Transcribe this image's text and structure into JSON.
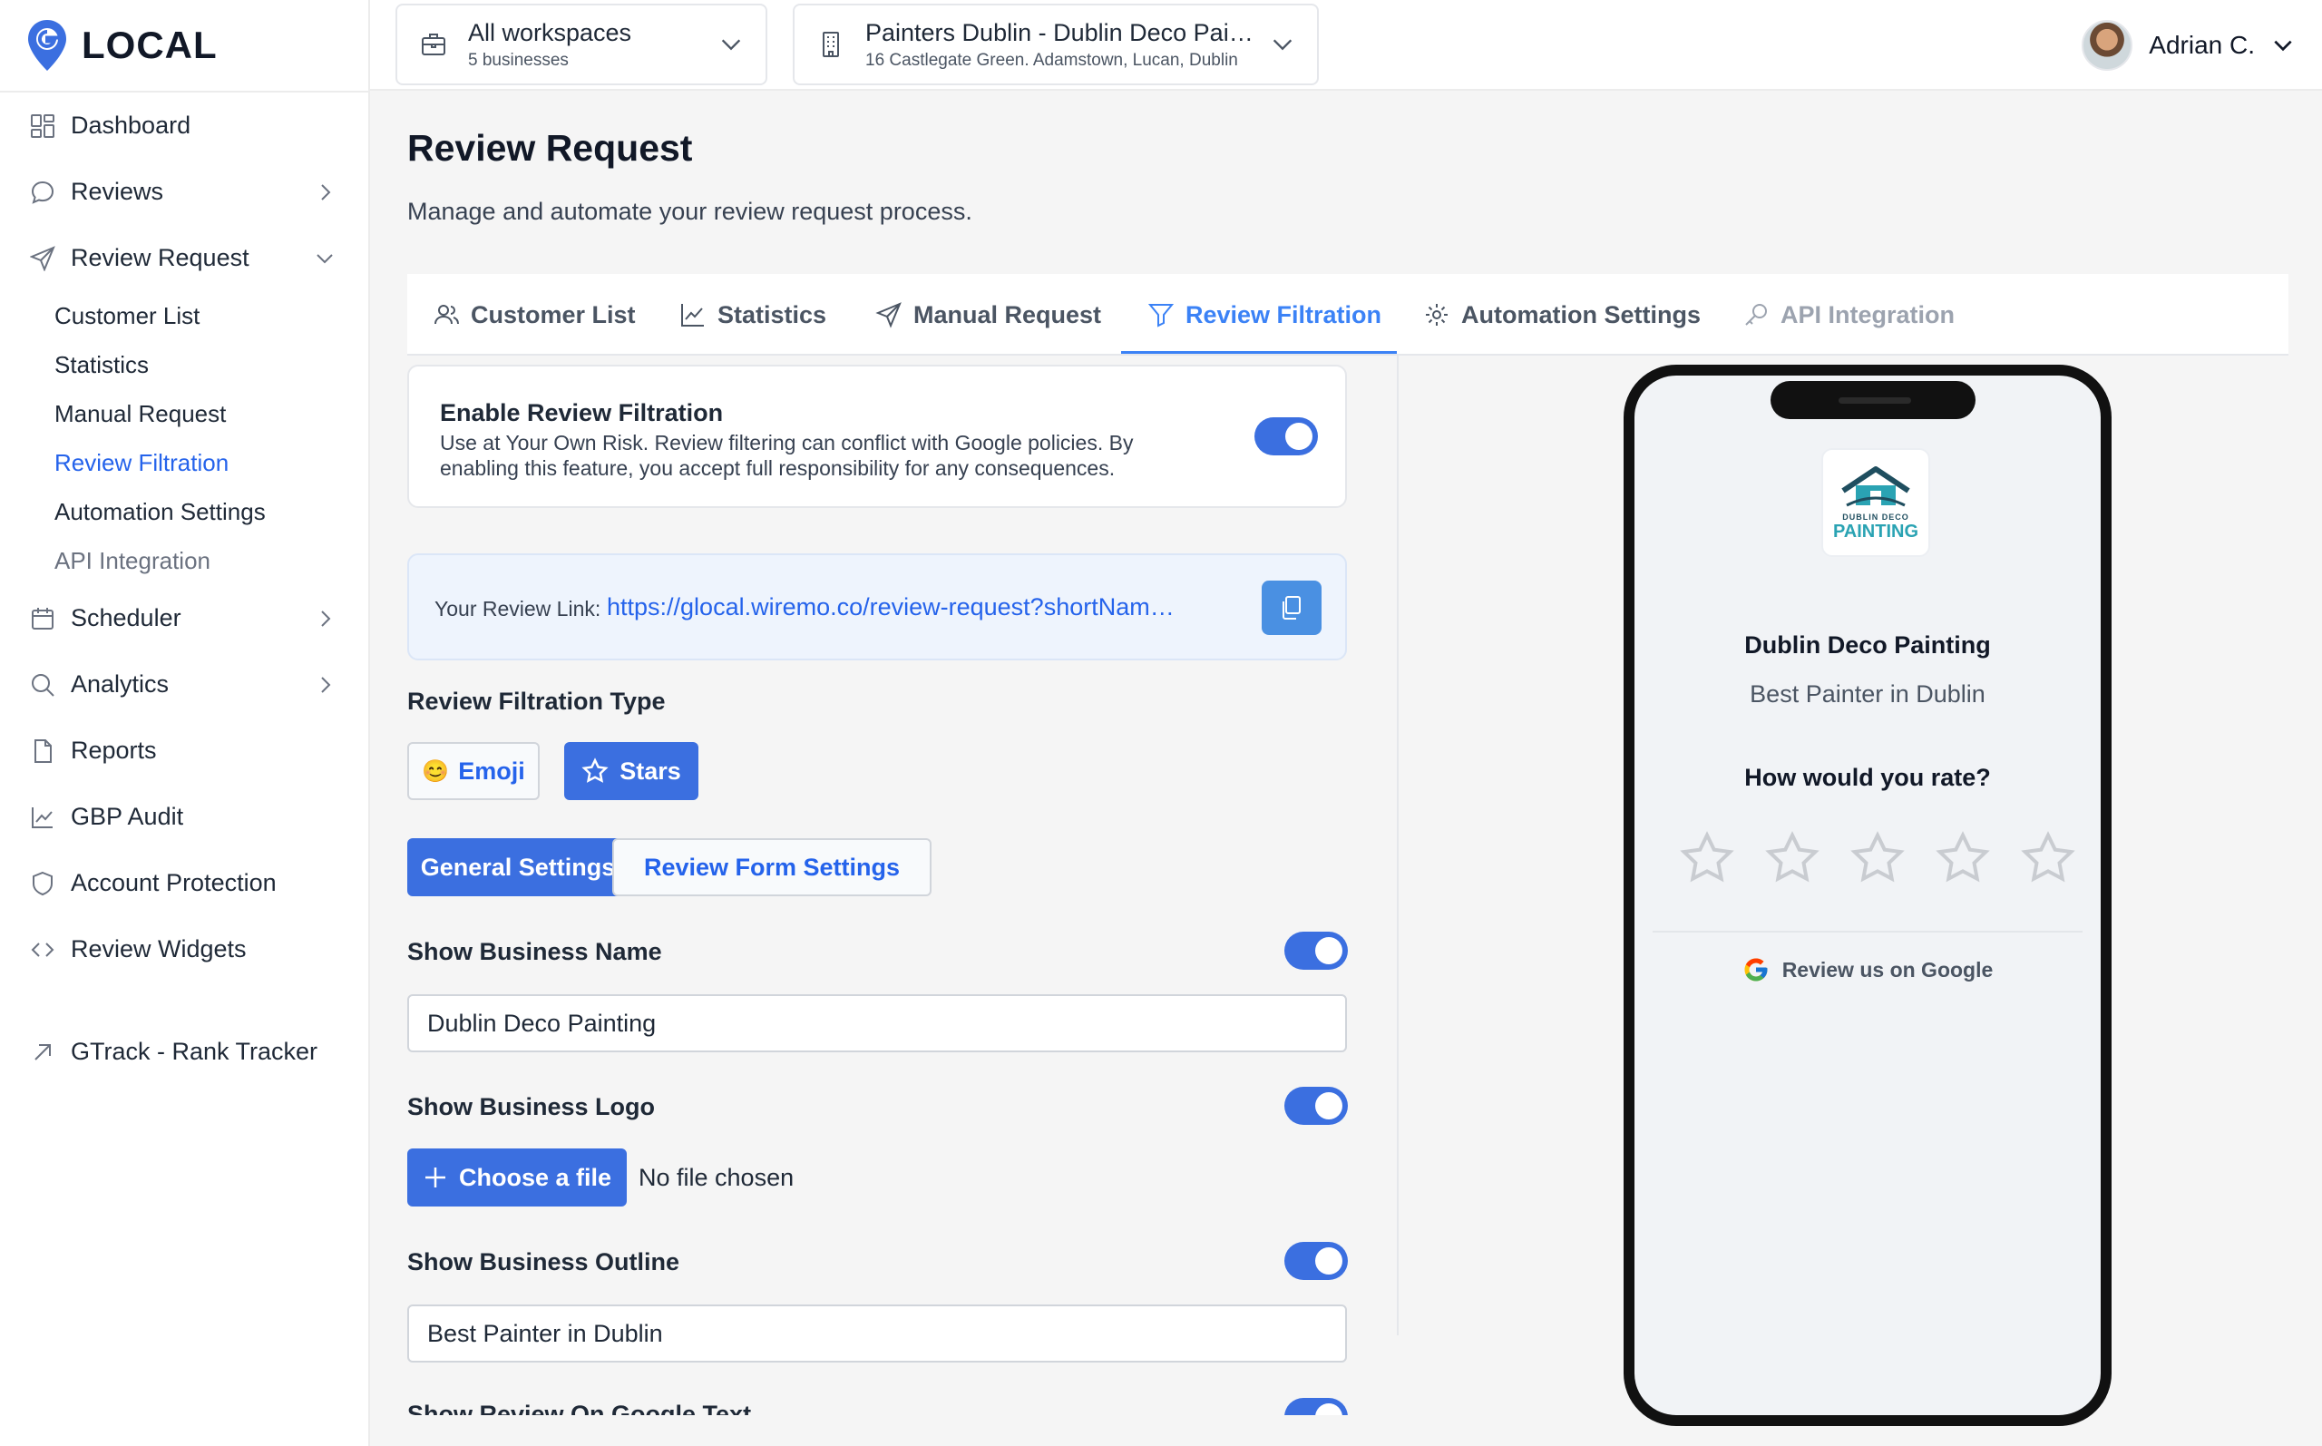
{
  "brand": {
    "name": "LOCAL"
  },
  "sidebar": {
    "items": [
      {
        "label": "Dashboard",
        "icon": "grid-icon"
      },
      {
        "label": "Reviews",
        "icon": "chat-icon"
      },
      {
        "label": "Review Request",
        "icon": "send-icon"
      },
      {
        "label": "Scheduler",
        "icon": "calendar-icon"
      },
      {
        "label": "Analytics",
        "icon": "search-icon"
      },
      {
        "label": "Reports",
        "icon": "file-icon"
      },
      {
        "label": "GBP Audit",
        "icon": "chart-line-icon"
      },
      {
        "label": "Account Protection",
        "icon": "shield-icon"
      },
      {
        "label": "Review Widgets",
        "icon": "code-icon"
      },
      {
        "label": "GTrack - Rank Tracker",
        "icon": "arrow-up-right-icon"
      }
    ],
    "sub_items": [
      "Customer List",
      "Statistics",
      "Manual Request",
      "Review Filtration",
      "Automation Settings",
      "API Integration"
    ]
  },
  "topbar": {
    "workspace": {
      "title": "All workspaces",
      "subtitle": "5 businesses"
    },
    "location": {
      "title": "Painters Dublin - Dublin Deco Painting",
      "subtitle": "16 Castlegate Green. Adamstown, Lucan, Dublin"
    },
    "user_name": "Adrian C."
  },
  "page": {
    "title": "Review Request",
    "subtitle": "Manage and automate your review request process."
  },
  "tabs": [
    "Customer List",
    "Statistics",
    "Manual Request",
    "Review Filtration",
    "Automation Settings",
    "API Integration"
  ],
  "filtration": {
    "title": "Enable Review Filtration",
    "description": "Use at Your Own Risk. Review filtering can conflict with Google policies. By enabling this feature, you accept full responsibility for any consequences.",
    "enabled": true
  },
  "review_link": {
    "label": "Your Review Link:",
    "url": "https://glocal.wiremo.co/review-request?shortName=dublin-deco-painting"
  },
  "filtration_type": {
    "label": "Review Filtration Type",
    "emoji_label": "Emoji",
    "emoji_glyph": "😊",
    "stars_label": "Stars"
  },
  "settings_tabs": {
    "general": "General Settings",
    "form": "Review Form Settings"
  },
  "fields": {
    "business_name_label": "Show Business Name",
    "business_name_value": "Dublin Deco Painting",
    "business_logo_label": "Show Business Logo",
    "choose_file": "Choose a file",
    "no_file": "No file chosen",
    "business_outline_label": "Show Business Outline",
    "business_outline_value": "Best Painter in Dublin",
    "review_on_google_label": "Show Review On Google Text"
  },
  "preview": {
    "logo_line1": "DUBLIN DECO",
    "logo_line2": "PAINTING",
    "business_name": "Dublin Deco Painting",
    "outline": "Best Painter in Dublin",
    "rate_question": "How would you rate?",
    "google_text": "Review us on Google",
    "star_count": 5
  },
  "colors": {
    "accent": "#3b6fe0",
    "link": "#2563eb",
    "sidebar_bg": "#ffffff"
  }
}
